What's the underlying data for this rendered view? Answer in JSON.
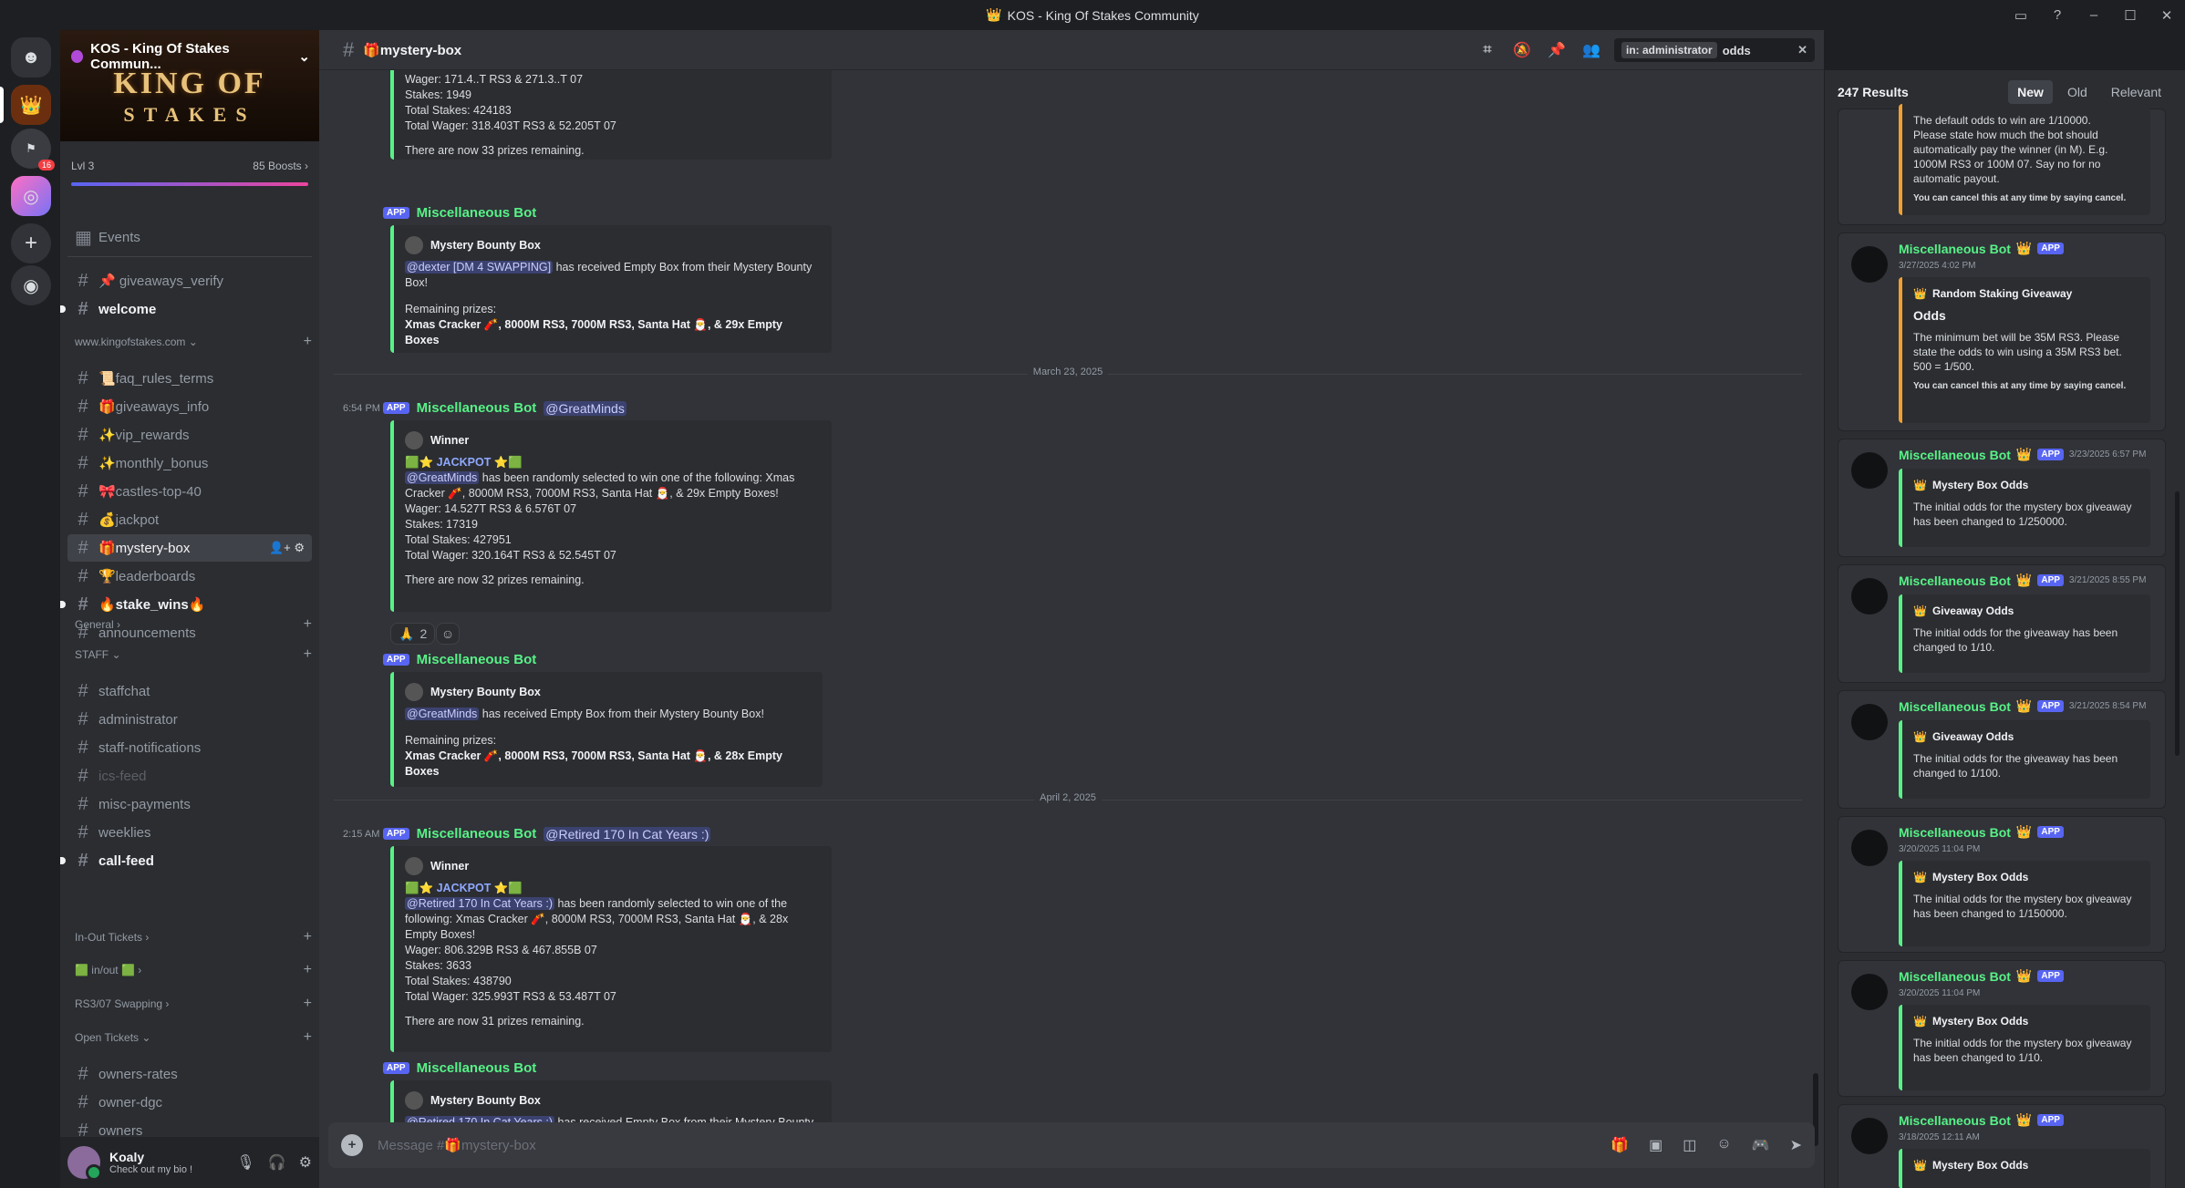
{
  "window": {
    "title": "KOS - King Of Stakes Community"
  },
  "server": {
    "name": "KOS - King Of Stakes Commun...",
    "level": "Lvl 3",
    "boosts": "85 Boosts",
    "banner_line1": "KING OF",
    "banner_line2": "STAKES",
    "notif_badge": "16"
  },
  "sidebar": {
    "events": "Events",
    "channels_top": [
      {
        "label": "📌 giveaways_verify"
      },
      {
        "label": "welcome"
      }
    ],
    "cat_site": "www.kingofstakes.com",
    "channels_site": [
      {
        "label": "📜faq_rules_terms"
      },
      {
        "label": "🎁giveaways_info"
      },
      {
        "label": "✨vip_rewards"
      },
      {
        "label": "✨monthly_bonus"
      },
      {
        "label": "🎀castles-top-40"
      },
      {
        "label": "💰jackpot"
      },
      {
        "label": "🎁mystery-box"
      },
      {
        "label": "🏆leaderboards"
      },
      {
        "label": "🔥stake_wins🔥"
      },
      {
        "label": "announcements"
      }
    ],
    "cat_general": "General",
    "cat_staff": "STAFF",
    "channels_staff": [
      {
        "label": "staffchat"
      },
      {
        "label": "administrator"
      },
      {
        "label": "staff-notifications"
      },
      {
        "label": "ics-feed"
      },
      {
        "label": "misc-payments"
      },
      {
        "label": "weeklies"
      },
      {
        "label": "call-feed"
      }
    ],
    "cat_inout": "In-Out Tickets",
    "cat_inout2": "in/out",
    "cat_swap": "RS3/07 Swapping",
    "cat_open": "Open Tickets",
    "channels_open": [
      {
        "label": "owners-rates"
      },
      {
        "label": "owner-dgc"
      },
      {
        "label": "owners"
      }
    ]
  },
  "user": {
    "name": "Koaly",
    "status": "Check out my bio !"
  },
  "channel": {
    "name": "🎁mystery-box",
    "composer_placeholder": "Message #🎁mystery-box"
  },
  "search": {
    "chip": "in: administrator",
    "query": "odds"
  },
  "messages": {
    "m0": {
      "partial1": "Wager: 171.4..T RS3 & 271.3..T 07",
      "stakes": "Stakes: 1949",
      "total_stakes": "Total Stakes: 424183",
      "total_wager": "Total Wager: 318.403T RS3 & 52.205T 07",
      "remaining": "There are now 33 prizes remaining."
    },
    "m1": {
      "author": "Miscellaneous Bot",
      "app": "APP",
      "title": "Mystery Bounty Box",
      "mention": "@dexter [DM 4 SWAPPING]",
      "body": "has received Empty Box from their Mystery Bounty Box!",
      "rem_label": "Remaining prizes:",
      "rem": "Xmas Cracker 🧨, 8000M RS3, 7000M RS3, Santa Hat 🎅, & 29x Empty Boxes"
    },
    "date1": "March 23, 2025",
    "m2": {
      "time": "6:54 PM",
      "author": "Miscellaneous Bot",
      "app": "APP",
      "mention": "@GreatMinds",
      "title": "Winner",
      "jackpot": "🟩⭐ JACKPOT ⭐🟩",
      "body_mention": "@GreatMinds",
      "body": "has been randomly selected to win one of the following: Xmas Cracker 🧨, 8000M RS3, 7000M RS3, Santa Hat 🎅, & 29x Empty Boxes!",
      "wager": "Wager: 14.527T RS3 & 6.576T 07",
      "stakes": "Stakes: 17319",
      "total_stakes": "Total Stakes: 427951",
      "total_wager": "Total Wager: 320.164T RS3 & 52.545T 07",
      "remaining": "There are now 32 prizes remaining.",
      "react_emoji": "🙏",
      "react_count": "2"
    },
    "m3": {
      "author": "Miscellaneous Bot",
      "app": "APP",
      "title": "Mystery Bounty Box",
      "mention": "@GreatMinds",
      "body": "has received Empty Box from their Mystery Bounty Box!",
      "rem_label": "Remaining prizes:",
      "rem": "Xmas Cracker 🧨, 8000M RS3, 7000M RS3, Santa Hat 🎅, & 28x Empty Boxes"
    },
    "date2": "April 2, 2025",
    "m4": {
      "time": "2:15 AM",
      "author": "Miscellaneous Bot",
      "app": "APP",
      "mention": "@Retired 170 In Cat Years :)",
      "title": "Winner",
      "jackpot": "🟩⭐ JACKPOT ⭐🟩",
      "body_mention": "@Retired 170 In Cat Years :)",
      "body": "has been randomly selected to win one of the following: Xmas Cracker 🧨, 8000M RS3, 7000M RS3, Santa Hat 🎅, & 28x Empty Boxes!",
      "wager": "Wager: 806.329B RS3 & 467.855B 07",
      "stakes": "Stakes: 3633",
      "total_stakes": "Total Stakes: 438790",
      "total_wager": "Total Wager: 325.993T RS3 & 53.487T 07",
      "remaining": "There are now 31 prizes remaining."
    },
    "m5": {
      "author": "Miscellaneous Bot",
      "app": "APP",
      "title": "Mystery Bounty Box",
      "mention": "@Retired 170 In Cat Years :)",
      "body": "has received Empty Box from their Mystery Bounty Box!"
    }
  },
  "results": {
    "count": "247 Results",
    "sort": [
      "New",
      "Old",
      "Relevant"
    ],
    "r0": {
      "lines": [
        "The default odds to win are 1/10000.",
        "Please state how much the bot should automatically pay the winner (in M). E.g. 1000M RS3 or 100M 07. Say no for no automatic payout."
      ],
      "small": "You can cancel this at any time by saying cancel."
    },
    "r1": {
      "name": "Miscellaneous Bot",
      "app": "APP",
      "time": "3/27/2025 4:02 PM",
      "title": "Random Staking Giveaway",
      "sub": "Odds",
      "body": "The minimum bet will be 35M RS3. Please state the odds to win using a 35M RS3 bet. 500 = 1/500.",
      "small": "You can cancel this at any time by saying cancel."
    },
    "r2": {
      "name": "Miscellaneous Bot",
      "app": "APP",
      "time": "3/23/2025 6:57 PM",
      "title": "Mystery Box Odds",
      "body": "The initial odds for the mystery box giveaway has been changed to 1/250000."
    },
    "r3": {
      "name": "Miscellaneous Bot",
      "app": "APP",
      "time": "3/21/2025 8:55 PM",
      "title": "Giveaway Odds",
      "body": "The initial odds for the giveaway has been changed to 1/10."
    },
    "r4": {
      "name": "Miscellaneous Bot",
      "app": "APP",
      "time": "3/21/2025 8:54 PM",
      "title": "Giveaway Odds",
      "body": "The initial odds for the giveaway has been changed to 1/100."
    },
    "r5": {
      "name": "Miscellaneous Bot",
      "app": "APP",
      "time": "3/20/2025 11:04 PM",
      "title": "Mystery Box Odds",
      "body": "The initial odds for the mystery box giveaway has been changed to 1/150000."
    },
    "r6": {
      "name": "Miscellaneous Bot",
      "app": "APP",
      "time": "3/20/2025 11:04 PM",
      "title": "Mystery Box Odds",
      "body": "The initial odds for the mystery box giveaway has been changed to 1/10."
    },
    "r7": {
      "name": "Miscellaneous Bot",
      "app": "APP",
      "time": "3/18/2025 12:11 AM",
      "title": "Mystery Box Odds"
    }
  },
  "colors": {
    "bot_green": "#57f287",
    "app_blurple": "#5865f2",
    "embed_orange": "#f0a030"
  }
}
